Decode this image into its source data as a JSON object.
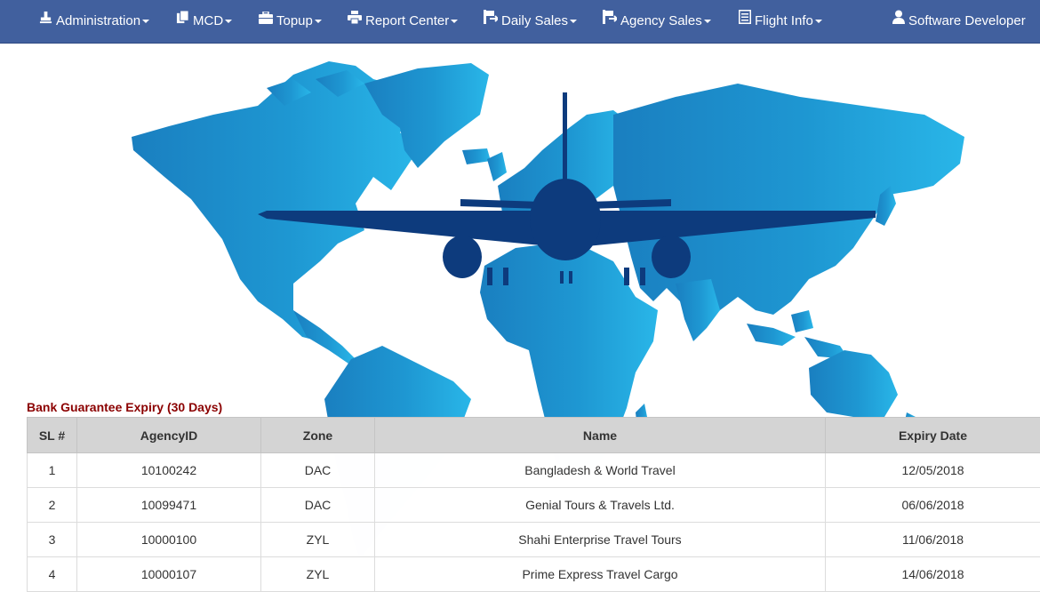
{
  "nav": {
    "items": [
      {
        "label": "Administration",
        "icon": "stamp-icon"
      },
      {
        "label": "MCD",
        "icon": "documents-icon"
      },
      {
        "label": "Topup",
        "icon": "briefcase-icon"
      },
      {
        "label": "Report Center",
        "icon": "printer-icon"
      },
      {
        "label": "Daily Sales",
        "icon": "sales-icon"
      },
      {
        "label": "Agency Sales",
        "icon": "sales-icon"
      },
      {
        "label": "Flight Info",
        "icon": "list-icon"
      }
    ],
    "user": {
      "label": "Software Developer",
      "icon": "user-icon"
    }
  },
  "colors": {
    "navbar": "#41609e",
    "map_light": "#29b6e8",
    "map_dark": "#1a7fc0",
    "plane": "#0d3b7d",
    "title": "#8b0000"
  },
  "report": {
    "title": "Bank Guarantee Expiry (30 Days)",
    "columns": [
      "SL #",
      "AgencyID",
      "Zone",
      "Name",
      "Expiry Date"
    ],
    "rows": [
      {
        "sl": "1",
        "agency_id": "10100242",
        "zone": "DAC",
        "name": "Bangladesh & World Travel",
        "expiry": "12/05/2018"
      },
      {
        "sl": "2",
        "agency_id": "10099471",
        "zone": "DAC",
        "name": "Genial Tours & Travels Ltd.",
        "expiry": "06/06/2018"
      },
      {
        "sl": "3",
        "agency_id": "10000100",
        "zone": "ZYL",
        "name": "Shahi Enterprise Travel Tours",
        "expiry": "11/06/2018"
      },
      {
        "sl": "4",
        "agency_id": "10000107",
        "zone": "ZYL",
        "name": "Prime Express Travel Cargo",
        "expiry": "14/06/2018"
      }
    ]
  }
}
